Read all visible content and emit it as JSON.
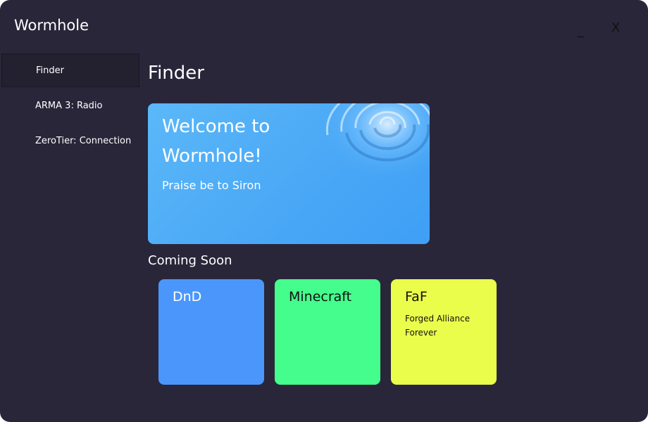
{
  "window": {
    "title": "Wormhole",
    "minimize_label": "_",
    "close_label": "X"
  },
  "sidebar": {
    "items": [
      {
        "label": "Finder",
        "active": true
      },
      {
        "label": "ARMA 3: Radio",
        "active": false
      },
      {
        "label": "ZeroTier: Connection",
        "active": false
      }
    ]
  },
  "main": {
    "title": "Finder",
    "hero": {
      "title": "Welcome to Wormhole!",
      "subtitle": "Praise be to Siron",
      "background_color": "#4aa8f6"
    },
    "coming_soon": {
      "title": "Coming Soon",
      "cards": [
        {
          "title": "DnD",
          "description": "",
          "color": "#4b96fb"
        },
        {
          "title": "Minecraft",
          "description": "",
          "color": "#45fd8c"
        },
        {
          "title": "FaF",
          "description": "Forged Alliance Forever",
          "color": "#ebfd4b"
        }
      ]
    }
  },
  "colors": {
    "window_background": "#29263a",
    "active_nav_background": "#23202f"
  }
}
